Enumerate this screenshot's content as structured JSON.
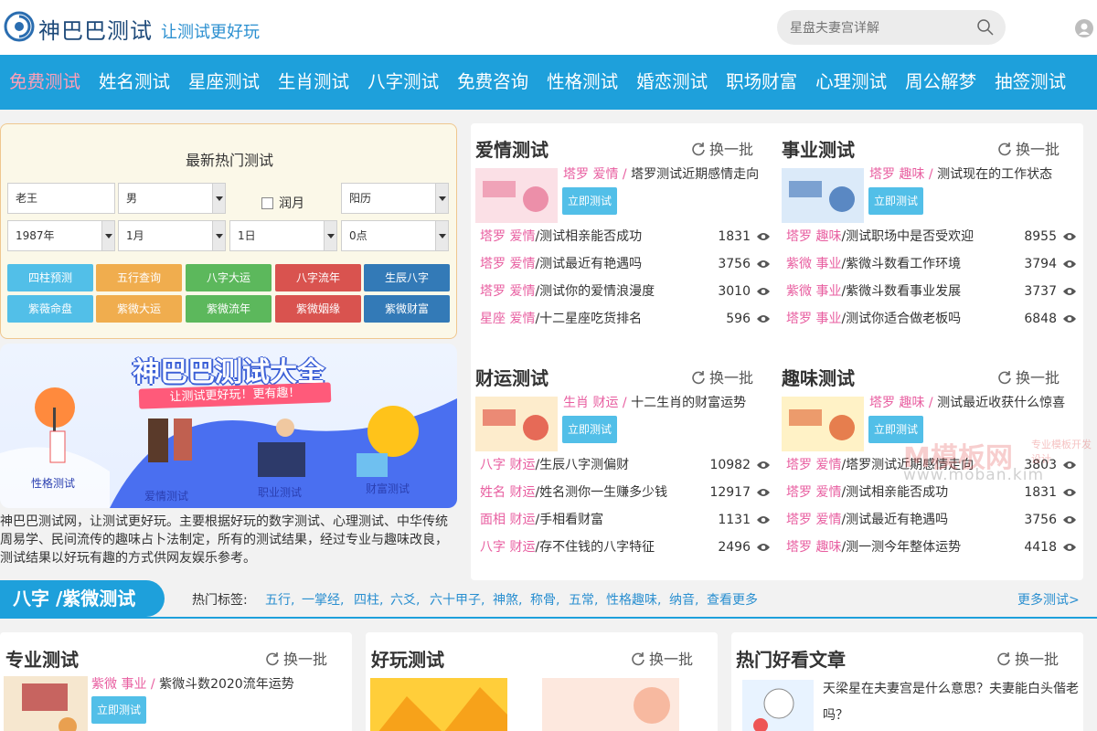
{
  "header": {
    "site_name": "神巴巴测试",
    "slogan": "让测试更好玩",
    "search_placeholder": "星盘夫妻宫详解"
  },
  "nav": [
    "免费测试",
    "姓名测试",
    "星座测试",
    "生肖测试",
    "八字测试",
    "免费咨询",
    "性格测试",
    "婚恋测试",
    "职场财富",
    "心理测试",
    "周公解梦",
    "抽签测试"
  ],
  "quick": {
    "title": "最新热门测试",
    "name_value": "老王",
    "gender": "男",
    "leap_label": "润月",
    "calendar": "阳历",
    "year": "1987年",
    "month": "1月",
    "day": "1日",
    "hour": "0点",
    "buttons": [
      {
        "label": "四柱预测",
        "color": "#52bfe8"
      },
      {
        "label": "五行查询",
        "color": "#f0ad4e"
      },
      {
        "label": "八字大运",
        "color": "#5cb85c"
      },
      {
        "label": "八字流年",
        "color": "#d9534f"
      },
      {
        "label": "生辰八字",
        "color": "#337ab7"
      },
      {
        "label": "紫薇命盘",
        "color": "#52bfe8"
      },
      {
        "label": "紫微大运",
        "color": "#f0ad4e"
      },
      {
        "label": "紫微流年",
        "color": "#5cb85c"
      },
      {
        "label": "紫微姻缘",
        "color": "#d9534f"
      },
      {
        "label": "紫微财富",
        "color": "#337ab7"
      }
    ]
  },
  "banner": {
    "title": "神巴巴测试大全",
    "ribbon": "让测试更好玩！更有趣！",
    "captions": [
      "性格测试",
      "爱情测试",
      "职业测试",
      "财富测试"
    ]
  },
  "intro": "神巴巴测试网，让测试更好玩。主要根据好玩的数字测试、心理测试、中华传统周易学、民间流传的趣味占卜法制定，所有的测试结果，经过专业与趣味改良，测试结果以好玩有趣的方式供网友娱乐参考。",
  "refresh_label": "换一批",
  "try_label": "立即测试",
  "categories": [
    {
      "title": "爱情测试",
      "featured": {
        "tag": "塔罗 爱情 /",
        "title": "塔罗测试近期感情走向"
      },
      "rows": [
        {
          "tag1": "塔罗",
          "tag2": "爱情",
          "name": "/测试相亲能否成功",
          "count": "1831"
        },
        {
          "tag1": "塔罗",
          "tag2": "爱情",
          "name": "/测试最近有艳遇吗",
          "count": "3756"
        },
        {
          "tag1": "塔罗",
          "tag2": "爱情",
          "name": "/测试你的爱情浪漫度",
          "count": "3010"
        },
        {
          "tag1": "星座",
          "tag2": "爱情",
          "name": "/十二星座吃货排名",
          "count": "596"
        }
      ]
    },
    {
      "title": "事业测试",
      "featured": {
        "tag": "塔罗 趣味 /",
        "title": "测试现在的工作状态"
      },
      "rows": [
        {
          "tag1": "塔罗",
          "tag2": "趣味",
          "name": "/测试职场中是否受欢迎",
          "count": "8955"
        },
        {
          "tag1": "紫微",
          "tag2": "事业",
          "name": "/紫微斗数看工作环境",
          "count": "3794"
        },
        {
          "tag1": "紫微",
          "tag2": "事业",
          "name": "/紫微斗数看事业发展",
          "count": "3737"
        },
        {
          "tag1": "塔罗",
          "tag2": "事业",
          "name": "/测试你适合做老板吗",
          "count": "6848"
        }
      ]
    },
    {
      "title": "财运测试",
      "featured": {
        "tag": "生肖 财运 /",
        "title": "十二生肖的财富运势"
      },
      "rows": [
        {
          "tag1": "八字",
          "tag2": "财运",
          "name": "/生辰八字测偏财",
          "count": "10982"
        },
        {
          "tag1": "姓名",
          "tag2": "财运",
          "name": "/姓名测你一生赚多少钱",
          "count": "12917"
        },
        {
          "tag1": "面相",
          "tag2": "财运",
          "name": "/手相看财富",
          "count": "1131"
        },
        {
          "tag1": "八字",
          "tag2": "财运",
          "name": "/存不住钱的八字特征",
          "count": "2496"
        }
      ]
    },
    {
      "title": "趣味测试",
      "featured": {
        "tag": "塔罗 趣味 /",
        "title": "测试最近收获什么惊喜"
      },
      "rows": [
        {
          "tag1": "塔罗",
          "tag2": "爱情",
          "name": "/塔罗测试近期感情走向",
          "count": "3803"
        },
        {
          "tag1": "塔罗",
          "tag2": "爱情",
          "name": "/测试相亲能否成功",
          "count": "1831"
        },
        {
          "tag1": "塔罗",
          "tag2": "爱情",
          "name": "/测试最近有艳遇吗",
          "count": "3756"
        },
        {
          "tag1": "塔罗",
          "tag2": "趣味",
          "name": "/测一测今年整体运势",
          "count": "4418"
        }
      ]
    }
  ],
  "section": {
    "title": "八字 /紫微测试",
    "hot_label": "热门标签:",
    "tags": [
      "五行,",
      "一掌经,",
      "四柱,",
      "六爻,",
      "六十甲子,",
      "神煞,",
      "称骨,",
      "五常,",
      "性格趣味,",
      "纳音,",
      "查看更多"
    ],
    "more": "更多测试>"
  },
  "bottom": {
    "pro": {
      "title": "专业测试",
      "tag": "紫微 事业 /",
      "featured_title": "紫微斗数2020流年运势"
    },
    "fun": {
      "title": "好玩测试"
    },
    "articles": {
      "title": "热门好看文章",
      "article_title": "天梁星在夫妻宫是什么意思？夫妻能白头偕老吗？"
    }
  },
  "watermark": {
    "brand": "M模板网",
    "sub": "专业模板开发设计",
    "url": "www.moban.kim"
  }
}
